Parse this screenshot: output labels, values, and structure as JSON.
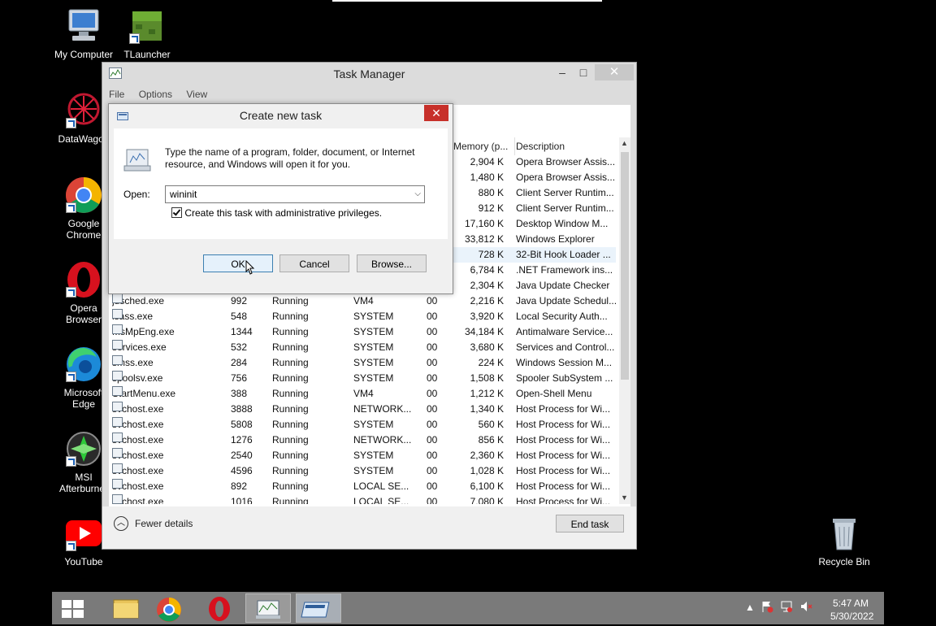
{
  "desktop": {
    "icons": [
      {
        "label": "My Computer"
      },
      {
        "label": "TLauncher"
      },
      {
        "label": "DataWagon"
      },
      {
        "label": "Google Chrome"
      },
      {
        "label": "Opera Browser"
      },
      {
        "label": "Microsoft Edge"
      },
      {
        "label": "MSI Afterburner"
      },
      {
        "label": "YouTube"
      },
      {
        "label": "Recycle Bin"
      }
    ]
  },
  "task_manager": {
    "title": "Task Manager",
    "menu": [
      "File",
      "Options",
      "View"
    ],
    "columns": {
      "memory": "Memory (p...",
      "description": "Description"
    },
    "processes": [
      {
        "name": "",
        "pid": "",
        "status": "",
        "user": "",
        "cpu": "",
        "memory": "2,904 K",
        "description": "Opera Browser Assis..."
      },
      {
        "name": "",
        "pid": "",
        "status": "",
        "user": "",
        "cpu": "",
        "memory": "1,480 K",
        "description": "Opera Browser Assis..."
      },
      {
        "name": "",
        "pid": "",
        "status": "",
        "user": "",
        "cpu": "",
        "memory": "880 K",
        "description": "Client Server Runtim..."
      },
      {
        "name": "",
        "pid": "",
        "status": "",
        "user": "",
        "cpu": "",
        "memory": "912 K",
        "description": "Client Server Runtim..."
      },
      {
        "name": "",
        "pid": "",
        "status": "",
        "user": "",
        "cpu": "",
        "memory": "17,160 K",
        "description": "Desktop Window M..."
      },
      {
        "name": "",
        "pid": "",
        "status": "",
        "user": "",
        "cpu": "",
        "memory": "33,812 K",
        "description": "Windows Explorer"
      },
      {
        "name": "",
        "pid": "",
        "status": "",
        "user": "",
        "cpu": "",
        "memory": "728 K",
        "description": "32-Bit Hook Loader ..."
      },
      {
        "name": "",
        "pid": "",
        "status": "",
        "user": "",
        "cpu": "",
        "memory": "6,784 K",
        "description": ".NET Framework ins..."
      },
      {
        "name": "",
        "pid": "",
        "status": "",
        "user": "",
        "cpu": "",
        "memory": "2,304 K",
        "description": "Java Update Checker"
      },
      {
        "name": "jusched.exe",
        "pid": "992",
        "status": "Running",
        "user": "VM4",
        "cpu": "00",
        "memory": "2,216 K",
        "description": "Java Update Schedul..."
      },
      {
        "name": "lsass.exe",
        "pid": "548",
        "status": "Running",
        "user": "SYSTEM",
        "cpu": "00",
        "memory": "3,920 K",
        "description": "Local Security Auth..."
      },
      {
        "name": "MsMpEng.exe",
        "pid": "1344",
        "status": "Running",
        "user": "SYSTEM",
        "cpu": "00",
        "memory": "34,184 K",
        "description": "Antimalware Service..."
      },
      {
        "name": "services.exe",
        "pid": "532",
        "status": "Running",
        "user": "SYSTEM",
        "cpu": "00",
        "memory": "3,680 K",
        "description": "Services and Control..."
      },
      {
        "name": "smss.exe",
        "pid": "284",
        "status": "Running",
        "user": "SYSTEM",
        "cpu": "00",
        "memory": "224 K",
        "description": "Windows Session M..."
      },
      {
        "name": "spoolsv.exe",
        "pid": "756",
        "status": "Running",
        "user": "SYSTEM",
        "cpu": "00",
        "memory": "1,508 K",
        "description": "Spooler SubSystem ..."
      },
      {
        "name": "StartMenu.exe",
        "pid": "388",
        "status": "Running",
        "user": "VM4",
        "cpu": "00",
        "memory": "1,212 K",
        "description": "Open-Shell Menu"
      },
      {
        "name": "svchost.exe",
        "pid": "3888",
        "status": "Running",
        "user": "NETWORK...",
        "cpu": "00",
        "memory": "1,340 K",
        "description": "Host Process for Wi..."
      },
      {
        "name": "svchost.exe",
        "pid": "5808",
        "status": "Running",
        "user": "SYSTEM",
        "cpu": "00",
        "memory": "560 K",
        "description": "Host Process for Wi..."
      },
      {
        "name": "svchost.exe",
        "pid": "1276",
        "status": "Running",
        "user": "NETWORK...",
        "cpu": "00",
        "memory": "856 K",
        "description": "Host Process for Wi..."
      },
      {
        "name": "svchost.exe",
        "pid": "2540",
        "status": "Running",
        "user": "SYSTEM",
        "cpu": "00",
        "memory": "2,360 K",
        "description": "Host Process for Wi..."
      },
      {
        "name": "svchost.exe",
        "pid": "4596",
        "status": "Running",
        "user": "SYSTEM",
        "cpu": "00",
        "memory": "1,028 K",
        "description": "Host Process for Wi..."
      },
      {
        "name": "svchost.exe",
        "pid": "892",
        "status": "Running",
        "user": "LOCAL SE...",
        "cpu": "00",
        "memory": "6,100 K",
        "description": "Host Process for Wi..."
      },
      {
        "name": "svchost.exe",
        "pid": "1016",
        "status": "Running",
        "user": "LOCAL SE...",
        "cpu": "00",
        "memory": "7,080 K",
        "description": "Host Process for Wi..."
      }
    ],
    "fewer_details": "Fewer details",
    "end_task": "End task"
  },
  "dialog": {
    "title": "Create new task",
    "close": "✕",
    "instruction": "Type the name of a program, folder, document, or Internet resource, and Windows will open it for you.",
    "open_label": "Open:",
    "open_value": "wininit",
    "admin_checkbox_label": "Create this task with administrative privileges.",
    "admin_checked": true,
    "ok": "OK",
    "cancel": "Cancel",
    "browse": "Browse..."
  },
  "taskbar": {
    "time": "5:47 AM",
    "date": "5/30/2022"
  }
}
